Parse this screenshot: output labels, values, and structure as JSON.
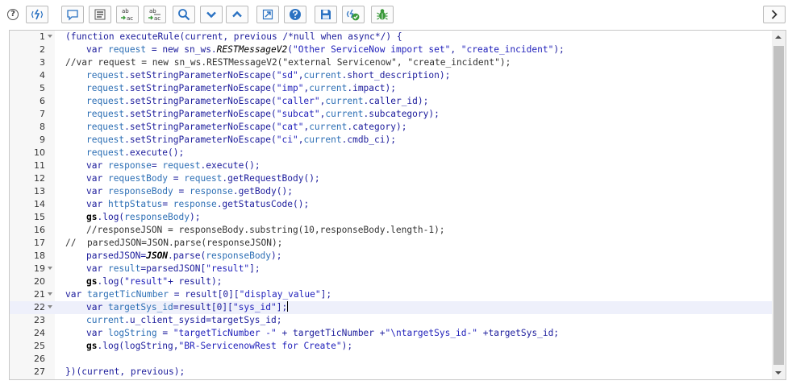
{
  "toolbar": {
    "help_glyph": "?",
    "sub_ab": "ab",
    "sub_ac": "ac",
    "buttons": [
      {
        "name": "toggle-syntax-editor-button",
        "icon": "syntax-toggle-icon"
      },
      {
        "name": "comment-button",
        "icon": "comment-icon"
      },
      {
        "name": "format-code-button",
        "icon": "format-icon"
      },
      {
        "name": "replace-button",
        "icon": "replace-icon"
      },
      {
        "name": "replace-all-button",
        "icon": "replace-all-icon"
      },
      {
        "name": "search-button",
        "icon": "search-icon"
      },
      {
        "name": "find-next-button",
        "icon": "chevron-down-icon"
      },
      {
        "name": "find-previous-button",
        "icon": "chevron-up-icon"
      },
      {
        "name": "fullscreen-button",
        "icon": "fullscreen-icon"
      },
      {
        "name": "help-button",
        "icon": "question-icon"
      },
      {
        "name": "save-button",
        "icon": "save-icon"
      },
      {
        "name": "check-syntax-button",
        "icon": "check-icon"
      },
      {
        "name": "debug-button",
        "icon": "bug-icon"
      },
      {
        "name": "expand-panel-button",
        "icon": "chevron-right-icon"
      }
    ]
  },
  "colors": {
    "default": "#1c1c9c",
    "variable": "#2d6fb5",
    "string": "#2222bb",
    "comment": "#333333",
    "bold": "#000000",
    "accent_blue": "#2b72c2",
    "accent_green": "#3a9a3a"
  },
  "editor": {
    "active_line": 22,
    "lines": [
      {
        "n": "1",
        "fold": true,
        "indent": 0,
        "tokens": [
          {
            "t": "(function executeRule(current, previous /*null when async*/) {",
            "c": "default"
          }
        ]
      },
      {
        "n": "2",
        "fold": false,
        "indent": 1,
        "tokens": [
          {
            "t": "var ",
            "c": "default"
          },
          {
            "t": "request",
            "c": "variable"
          },
          {
            "t": " = new sn_ws.",
            "c": "default"
          },
          {
            "t": "RESTMessageV2",
            "c": "bold",
            "i": true
          },
          {
            "t": "(",
            "c": "default"
          },
          {
            "t": "\"Other ServiceNow import set\"",
            "c": "string"
          },
          {
            "t": ", ",
            "c": "default"
          },
          {
            "t": "\"create_incident\"",
            "c": "string"
          },
          {
            "t": ");",
            "c": "default"
          }
        ]
      },
      {
        "n": "3",
        "fold": false,
        "indent": 0,
        "tokens": [
          {
            "t": "//var request = new sn_ws.RESTMessageV2(\"external Servicenow\", \"create_incident\");",
            "c": "comment"
          }
        ]
      },
      {
        "n": "4",
        "fold": false,
        "indent": 1,
        "tokens": [
          {
            "t": "request",
            "c": "variable"
          },
          {
            "t": ".setStringParameterNoEscape(",
            "c": "default"
          },
          {
            "t": "\"sd\"",
            "c": "string"
          },
          {
            "t": ",",
            "c": "default"
          },
          {
            "t": "current",
            "c": "variable"
          },
          {
            "t": ".short_description);",
            "c": "default"
          }
        ]
      },
      {
        "n": "5",
        "fold": false,
        "indent": 1,
        "tokens": [
          {
            "t": "request",
            "c": "variable"
          },
          {
            "t": ".setStringParameterNoEscape(",
            "c": "default"
          },
          {
            "t": "\"imp\"",
            "c": "string"
          },
          {
            "t": ",",
            "c": "default"
          },
          {
            "t": "current",
            "c": "variable"
          },
          {
            "t": ".impact);",
            "c": "default"
          }
        ]
      },
      {
        "n": "6",
        "fold": false,
        "indent": 1,
        "tokens": [
          {
            "t": "request",
            "c": "variable"
          },
          {
            "t": ".setStringParameterNoEscape(",
            "c": "default"
          },
          {
            "t": "\"caller\"",
            "c": "string"
          },
          {
            "t": ",",
            "c": "default"
          },
          {
            "t": "current",
            "c": "variable"
          },
          {
            "t": ".caller_id);",
            "c": "default"
          }
        ]
      },
      {
        "n": "7",
        "fold": false,
        "indent": 1,
        "tokens": [
          {
            "t": "request",
            "c": "variable"
          },
          {
            "t": ".setStringParameterNoEscape(",
            "c": "default"
          },
          {
            "t": "\"subcat\"",
            "c": "string"
          },
          {
            "t": ",",
            "c": "default"
          },
          {
            "t": "current",
            "c": "variable"
          },
          {
            "t": ".subcategory);",
            "c": "default"
          }
        ]
      },
      {
        "n": "8",
        "fold": false,
        "indent": 1,
        "tokens": [
          {
            "t": "request",
            "c": "variable"
          },
          {
            "t": ".setStringParameterNoEscape(",
            "c": "default"
          },
          {
            "t": "\"cat\"",
            "c": "string"
          },
          {
            "t": ",",
            "c": "default"
          },
          {
            "t": "current",
            "c": "variable"
          },
          {
            "t": ".category);",
            "c": "default"
          }
        ]
      },
      {
        "n": "9",
        "fold": false,
        "indent": 1,
        "tokens": [
          {
            "t": "request",
            "c": "variable"
          },
          {
            "t": ".setStringParameterNoEscape(",
            "c": "default"
          },
          {
            "t": "\"ci\"",
            "c": "string"
          },
          {
            "t": ",",
            "c": "default"
          },
          {
            "t": "current",
            "c": "variable"
          },
          {
            "t": ".cmdb_ci);",
            "c": "default"
          }
        ]
      },
      {
        "n": "10",
        "fold": false,
        "indent": 1,
        "tokens": [
          {
            "t": "request",
            "c": "variable"
          },
          {
            "t": ".execute();",
            "c": "default"
          }
        ]
      },
      {
        "n": "11",
        "fold": false,
        "indent": 1,
        "tokens": [
          {
            "t": "var ",
            "c": "default"
          },
          {
            "t": "response",
            "c": "variable"
          },
          {
            "t": "= ",
            "c": "default"
          },
          {
            "t": "request",
            "c": "variable"
          },
          {
            "t": ".execute();",
            "c": "default"
          }
        ]
      },
      {
        "n": "12",
        "fold": false,
        "indent": 1,
        "tokens": [
          {
            "t": "var ",
            "c": "default"
          },
          {
            "t": "requestBody",
            "c": "variable"
          },
          {
            "t": " = ",
            "c": "default"
          },
          {
            "t": "request",
            "c": "variable"
          },
          {
            "t": ".getRequestBody();",
            "c": "default"
          }
        ]
      },
      {
        "n": "13",
        "fold": false,
        "indent": 1,
        "tokens": [
          {
            "t": "var ",
            "c": "default"
          },
          {
            "t": "responseBody",
            "c": "variable"
          },
          {
            "t": " = ",
            "c": "default"
          },
          {
            "t": "response",
            "c": "variable"
          },
          {
            "t": ".getBody();",
            "c": "default"
          }
        ]
      },
      {
        "n": "14",
        "fold": false,
        "indent": 1,
        "tokens": [
          {
            "t": "var ",
            "c": "default"
          },
          {
            "t": "httpStatus",
            "c": "variable"
          },
          {
            "t": "= ",
            "c": "default"
          },
          {
            "t": "response",
            "c": "variable"
          },
          {
            "t": ".getStatusCode();",
            "c": "default"
          }
        ]
      },
      {
        "n": "15",
        "fold": false,
        "indent": 1,
        "tokens": [
          {
            "t": "gs",
            "c": "bold",
            "b": true
          },
          {
            "t": ".log(",
            "c": "default"
          },
          {
            "t": "responseBody",
            "c": "variable"
          },
          {
            "t": ");",
            "c": "default"
          }
        ]
      },
      {
        "n": "16",
        "fold": false,
        "indent": 1,
        "tokens": [
          {
            "t": "//responseJSON = responseBody.substring(10,responseBody.length-1);",
            "c": "comment"
          }
        ]
      },
      {
        "n": "17",
        "fold": false,
        "indent": 0,
        "tokens": [
          {
            "t": "//  parsedJSON=JSON.parse(responseJSON);",
            "c": "comment"
          }
        ]
      },
      {
        "n": "18",
        "fold": false,
        "indent": 1,
        "tokens": [
          {
            "t": "parsedJSON=",
            "c": "default"
          },
          {
            "t": "JSON",
            "c": "bold",
            "b": true,
            "i": true
          },
          {
            "t": ".parse(",
            "c": "default"
          },
          {
            "t": "responseBody",
            "c": "variable"
          },
          {
            "t": ");",
            "c": "default"
          }
        ]
      },
      {
        "n": "19",
        "fold": true,
        "indent": 1,
        "tokens": [
          {
            "t": "var ",
            "c": "default"
          },
          {
            "t": "result",
            "c": "variable"
          },
          {
            "t": "=parsedJSON[",
            "c": "default"
          },
          {
            "t": "\"result\"",
            "c": "string"
          },
          {
            "t": "];",
            "c": "default"
          }
        ]
      },
      {
        "n": "20",
        "fold": false,
        "indent": 1,
        "tokens": [
          {
            "t": "gs",
            "c": "bold",
            "b": true
          },
          {
            "t": ".log(",
            "c": "default"
          },
          {
            "t": "\"result\"",
            "c": "string"
          },
          {
            "t": "+ result);",
            "c": "default"
          }
        ]
      },
      {
        "n": "21",
        "fold": true,
        "indent": 0,
        "tokens": [
          {
            "t": "var ",
            "c": "default"
          },
          {
            "t": "targetTicNumber",
            "c": "variable"
          },
          {
            "t": " = result[0][",
            "c": "default"
          },
          {
            "t": "\"display_value\"",
            "c": "string"
          },
          {
            "t": "];",
            "c": "default"
          }
        ]
      },
      {
        "n": "22",
        "fold": true,
        "indent": 1,
        "cursor": true,
        "tokens": [
          {
            "t": "var ",
            "c": "default"
          },
          {
            "t": "targetSys_id",
            "c": "variable"
          },
          {
            "t": "=result[0][",
            "c": "default"
          },
          {
            "t": "\"sys_id\"",
            "c": "string"
          },
          {
            "t": "];",
            "c": "default"
          }
        ]
      },
      {
        "n": "23",
        "fold": false,
        "indent": 1,
        "tokens": [
          {
            "t": "current",
            "c": "variable"
          },
          {
            "t": ".u_client_sysid=targetSys_id;",
            "c": "default"
          }
        ]
      },
      {
        "n": "24",
        "fold": false,
        "indent": 1,
        "tokens": [
          {
            "t": "var ",
            "c": "default"
          },
          {
            "t": "logString",
            "c": "variable"
          },
          {
            "t": " = ",
            "c": "default"
          },
          {
            "t": "\"targetTicNumber -\"",
            "c": "string"
          },
          {
            "t": " + targetTicNumber +",
            "c": "default"
          },
          {
            "t": "\"\\ntargetSys_id-\"",
            "c": "string"
          },
          {
            "t": " +targetSys_id;",
            "c": "default"
          }
        ]
      },
      {
        "n": "25",
        "fold": false,
        "indent": 1,
        "tokens": [
          {
            "t": "gs",
            "c": "bold",
            "b": true
          },
          {
            "t": ".log(logString,",
            "c": "default"
          },
          {
            "t": "\"BR-ServicenowRest for Create\"",
            "c": "string"
          },
          {
            "t": ");",
            "c": "default"
          }
        ]
      },
      {
        "n": "26",
        "fold": false,
        "indent": 0,
        "tokens": []
      },
      {
        "n": "27",
        "fold": false,
        "indent": 0,
        "tokens": [
          {
            "t": "})(current, previous);",
            "c": "default"
          }
        ]
      }
    ]
  }
}
